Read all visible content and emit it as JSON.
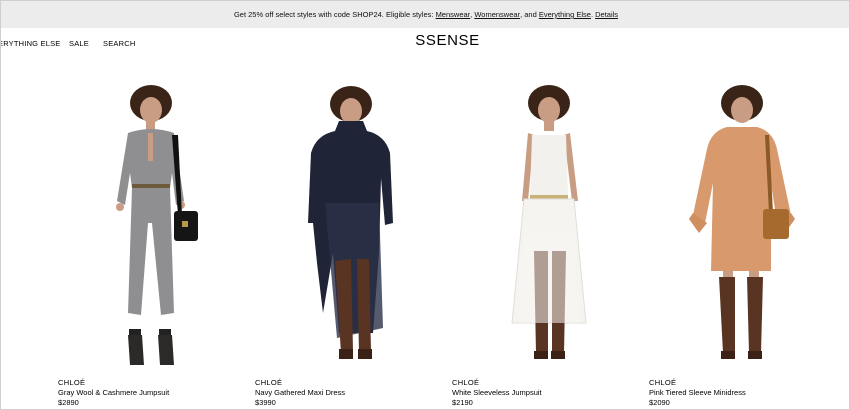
{
  "promo": {
    "prefix": "Get 25% off select styles with code SHOP24. Eligible styles: ",
    "links": [
      "Menswear",
      "Womenswear",
      "Everything Else"
    ],
    "sep1": ", ",
    "sep2": ", and ",
    "sep3": ". ",
    "details": "Details"
  },
  "nav": {
    "everything_else": "ERYTHING ELSE",
    "sale": "SALE",
    "search": "SEARCH"
  },
  "logo": "SSENSE",
  "products": [
    {
      "brand": "CHLOÉ",
      "name": "Gray Wool & Cashmere Jumpsuit",
      "price": "$2890",
      "color": "#8f8f91"
    },
    {
      "brand": "CHLOÉ",
      "name": "Navy Gathered Maxi Dress",
      "price": "$3990",
      "color": "#1f2436"
    },
    {
      "brand": "CHLOÉ",
      "name": "White Sleeveless Jumpsuit",
      "price": "$2190",
      "color": "#f3f1ee"
    },
    {
      "brand": "CHLOÉ",
      "name": "Pink Tiered Sleeve Minidress",
      "price": "$2090",
      "color": "#d89a6c"
    }
  ],
  "colors": {
    "promo_bg": "#ececec",
    "skin": "#c99c84",
    "hair": "#3a2417",
    "boots": "#5a3422"
  }
}
